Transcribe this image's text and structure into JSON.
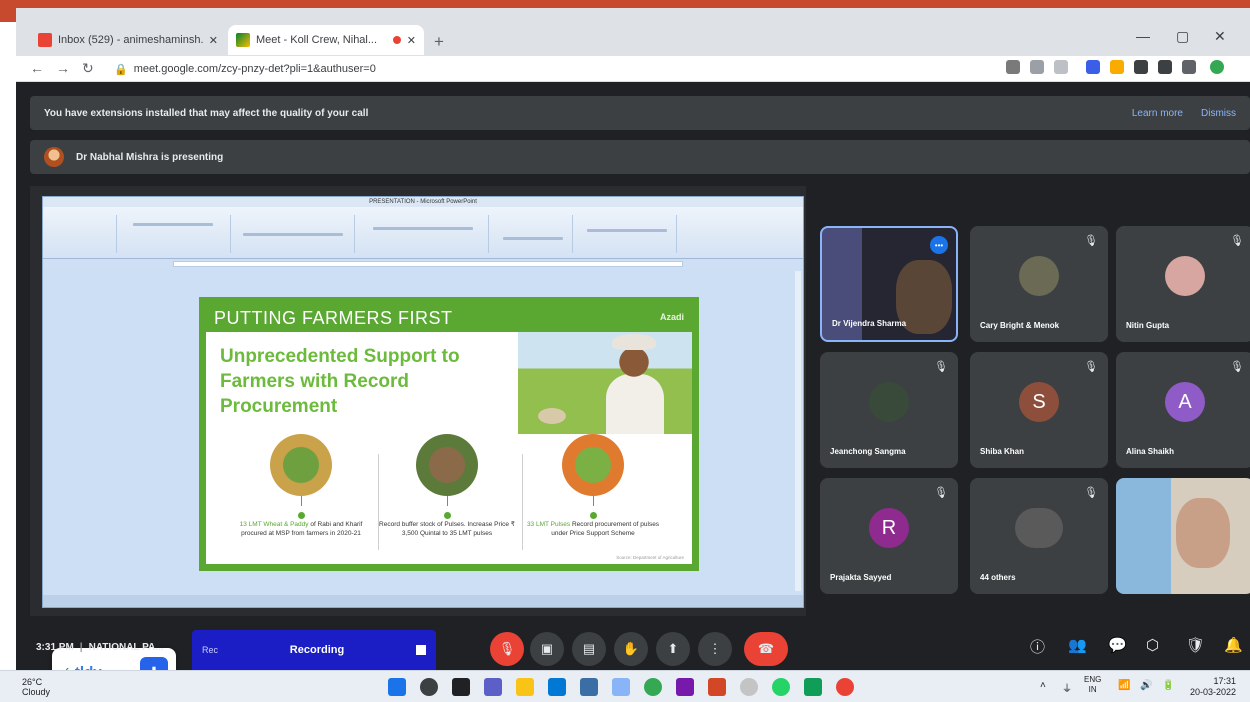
{
  "browser": {
    "tabs": [
      {
        "title": "Inbox (529) - animeshaminsh...",
        "active": false
      },
      {
        "title": "Meet - Koll Crew, Nihal...",
        "active": true
      }
    ],
    "new_tab": "+",
    "url": "meet.google.com/zcy-pnzy-det?pli=1&authuser=0",
    "nav": {
      "back": "←",
      "forward": "→",
      "reload": "↻"
    },
    "window_controls": {
      "minimize": "—",
      "restore": "▢",
      "close": "✕"
    }
  },
  "meet": {
    "warning_text": "You have extensions installed that may affect the quality of your call",
    "warning_learn_more": "Learn more",
    "warning_dismiss": "Dismiss",
    "presenting_text": "Dr Nabhal Mishra is presenting",
    "ppt_window_title": "PRESENTATION - Microsoft PowerPoint",
    "slide": {
      "header": "PUTTING FARMERS FIRST",
      "logo": "Azadi",
      "headline": "Unprecedented Support to Farmers with Record Procurement",
      "bullets": [
        {
          "highlight": "13 LMT Wheat & Paddy",
          "text": "of Rabi and Kharif procured at MSP from farmers in 2020-21"
        },
        {
          "highlight": "",
          "text": "Record buffer stock of Pulses. Increase Price ₹ 3,500 Quintal to 35 LMT pulses"
        },
        {
          "highlight": "33 LMT Pulses",
          "text": "Record procurement of pulses under Price Support Scheme"
        }
      ],
      "footnote": "Source: Department of Agriculture"
    },
    "tldv": {
      "logo": "tldv",
      "check": "✓",
      "action": "⬇"
    },
    "participants": [
      {
        "name": "Dr Vijendra Sharma",
        "type": "video",
        "speaking": true
      },
      {
        "name": "Cary Bright & Menok",
        "initial": "",
        "color": "#6b6b55"
      },
      {
        "name": "Nitin Gupta",
        "initial": "",
        "color": "#d7a6a0"
      },
      {
        "name": "Jeanchong Sangma",
        "initial": "",
        "color": "#3a4a3a"
      },
      {
        "name": "Shiba Khan",
        "initial": "S",
        "color": "#8d4f3c"
      },
      {
        "name": "Alina Shaikh",
        "initial": "A",
        "color": "#8f5bc7"
      },
      {
        "name": "Prajakta Sayyed",
        "initial": "R",
        "color": "#8f2b8f"
      },
      {
        "name": "44 others",
        "initial": "",
        "color": "#5a5a5a"
      },
      {
        "name": "",
        "type": "video2"
      }
    ],
    "meeting_time": "3:31 PM",
    "meeting_name": "NATIONAL PA...",
    "recording_label": "Recording",
    "recording_sub": "Rec"
  },
  "taskbar": {
    "weather_temp": "26°C",
    "weather_text": "Cloudy",
    "language": "ENG",
    "language_sub": "IN",
    "clock_time": "17:31",
    "clock_date": "20-03-2022"
  },
  "colors": {
    "meet_bg": "#202124",
    "slide_green": "#5aa832",
    "hangup_red": "#ea4335",
    "record_blue": "#1a1ec4"
  }
}
